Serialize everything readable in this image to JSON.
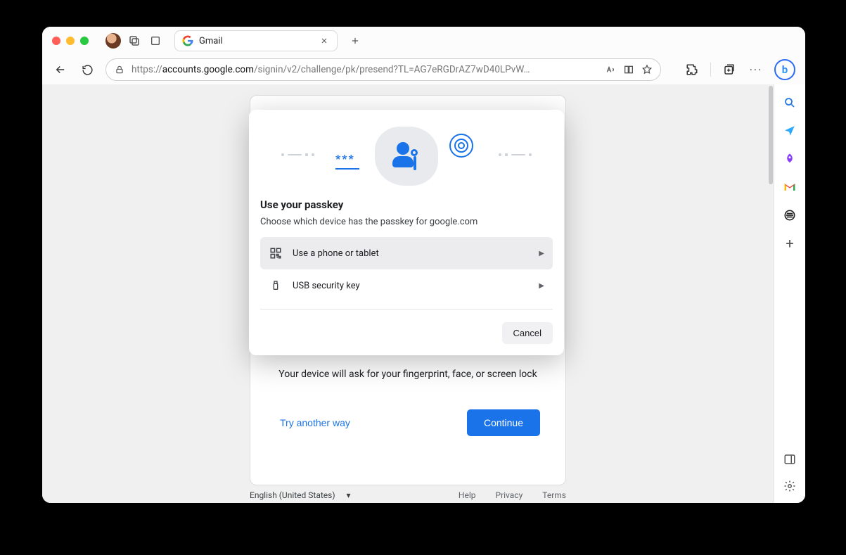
{
  "tab": {
    "title": "Gmail"
  },
  "address": {
    "host": "accounts.google.com",
    "prefix": "https://",
    "path": "/signin/v2/challenge/pk/presend?TL=AG7eRGDrAZ7wD40LPvW…"
  },
  "card": {
    "body_text": "Your device will ask for your fingerprint, face, or screen lock",
    "try_another": "Try another way",
    "continue": "Continue"
  },
  "footer": {
    "language": "English (United States)",
    "help": "Help",
    "privacy": "Privacy",
    "terms": "Terms"
  },
  "dialog": {
    "title": "Use your passkey",
    "subtitle": "Choose which device has the passkey for google.com",
    "option_phone": "Use a phone or tablet",
    "option_usb": "USB security key",
    "cancel": "Cancel"
  }
}
